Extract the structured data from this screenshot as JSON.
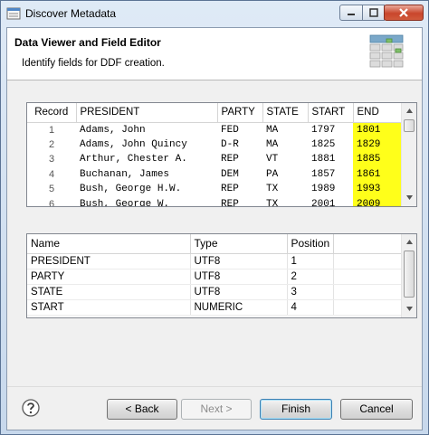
{
  "window": {
    "title": "Discover Metadata"
  },
  "header": {
    "title": "Data Viewer and Field Editor",
    "subtitle": "Identify fields for DDF creation."
  },
  "records": {
    "columns": [
      "Record",
      "PRESIDENT",
      "PARTY",
      "STATE",
      "START",
      "END"
    ],
    "rows": [
      [
        "1",
        "Adams, John",
        "FED",
        "MA",
        "1797",
        "1801"
      ],
      [
        "2",
        "Adams, John Quincy",
        "D-R",
        "MA",
        "1825",
        "1829"
      ],
      [
        "3",
        "Arthur, Chester A.",
        "REP",
        "VT",
        "1881",
        "1885"
      ],
      [
        "4",
        "Buchanan, James",
        "DEM",
        "PA",
        "1857",
        "1861"
      ],
      [
        "5",
        "Bush, George H.W.",
        "REP",
        "TX",
        "1989",
        "1993"
      ],
      [
        "6",
        "Bush, George W.",
        "REP",
        "TX",
        "2001",
        "2009"
      ]
    ],
    "highlight_color": "#ffff1a"
  },
  "fields": {
    "columns": [
      "Name",
      "Type",
      "Position"
    ],
    "rows": [
      [
        "PRESIDENT",
        "UTF8",
        "1"
      ],
      [
        "PARTY",
        "UTF8",
        "2"
      ],
      [
        "STATE",
        "UTF8",
        "3"
      ],
      [
        "START",
        "NUMERIC",
        "4"
      ]
    ]
  },
  "buttons": {
    "back": "< Back",
    "next": "Next >",
    "finish": "Finish",
    "cancel": "Cancel"
  },
  "icons": {
    "help": "help-icon",
    "minimize": "minimize-icon",
    "maximize": "maximize-icon",
    "close": "close-icon"
  }
}
